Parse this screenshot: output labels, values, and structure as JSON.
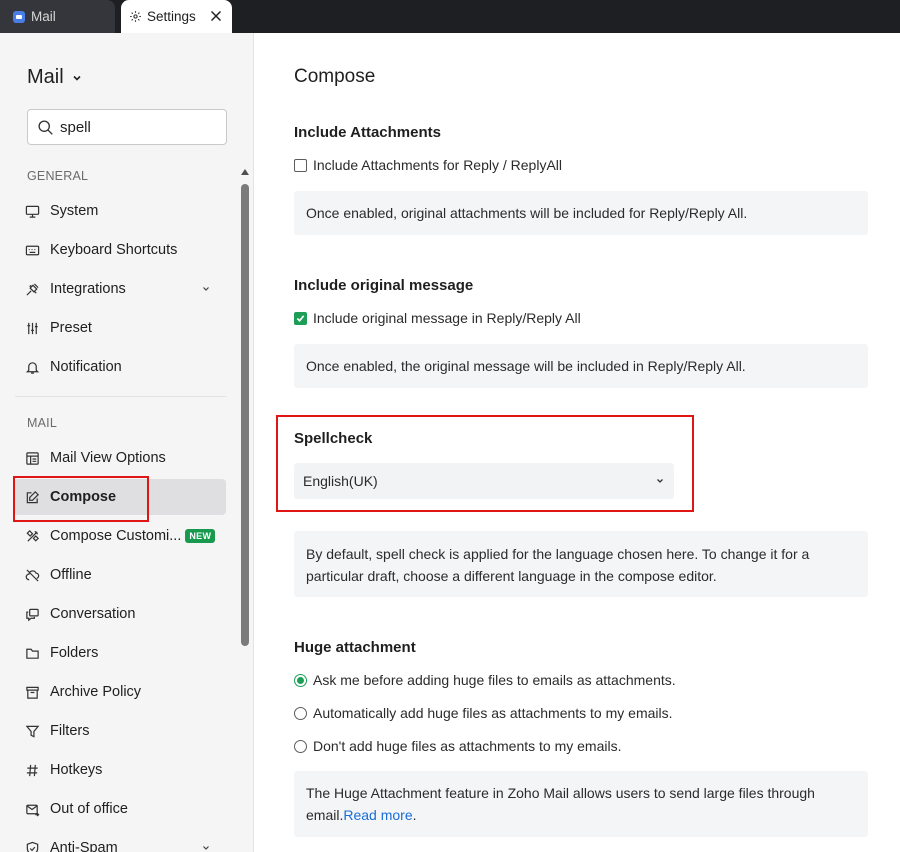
{
  "tabs": [
    {
      "label": "Mail"
    },
    {
      "label": "Settings"
    }
  ],
  "sidebar": {
    "app_title": "Mail",
    "search": {
      "value": "spell",
      "placeholder": "Search"
    },
    "general_label": "GENERAL",
    "general_items": [
      {
        "label": "System",
        "icon": "monitor-icon"
      },
      {
        "label": "Keyboard Shortcuts",
        "icon": "keyboard-icon"
      },
      {
        "label": "Integrations",
        "icon": "plug-icon",
        "expandable": true
      },
      {
        "label": "Preset",
        "icon": "sliders-icon"
      },
      {
        "label": "Notification",
        "icon": "bell-icon"
      }
    ],
    "mail_label": "MAIL",
    "mail_items": [
      {
        "label": "Mail View Options",
        "icon": "layout-icon"
      },
      {
        "label": "Compose",
        "icon": "edit-icon",
        "active": true
      },
      {
        "label": "Compose Customi...",
        "icon": "tools-icon",
        "badge": "NEW"
      },
      {
        "label": "Offline",
        "icon": "cloud-off-icon"
      },
      {
        "label": "Conversation",
        "icon": "chat-icon"
      },
      {
        "label": "Folders",
        "icon": "folder-icon"
      },
      {
        "label": "Archive Policy",
        "icon": "archive-icon"
      },
      {
        "label": "Filters",
        "icon": "filter-icon"
      },
      {
        "label": "Hotkeys",
        "icon": "hash-icon"
      },
      {
        "label": "Out of office",
        "icon": "mail-out-icon"
      },
      {
        "label": "Anti-Spam",
        "icon": "shield-check-icon",
        "expandable": true
      }
    ]
  },
  "main": {
    "title": "Compose",
    "attachments": {
      "heading": "Include Attachments",
      "option": "Include Attachments for Reply / ReplyAll",
      "checked": false,
      "info": "Once enabled, original attachments will be included for Reply/Reply All."
    },
    "original": {
      "heading": "Include original message",
      "option": "Include original message in Reply/Reply All",
      "checked": true,
      "info": "Once enabled, the original message will be included in Reply/Reply All."
    },
    "spellcheck": {
      "heading": "Spellcheck",
      "selected": "English(UK)",
      "info": "By default, spell check is applied for the language chosen here. To change it for a particular draft, choose a different language in the compose editor."
    },
    "huge": {
      "heading": "Huge attachment",
      "options": [
        {
          "label": "Ask me before adding huge files to emails as attachments.",
          "selected": true
        },
        {
          "label": "Automatically add huge files as attachments to my emails.",
          "selected": false
        },
        {
          "label": "Don't add huge files as attachments to my emails.",
          "selected": false
        }
      ],
      "info_text": "The Huge Attachment feature in Zoho Mail allows users to send large files through email.",
      "info_link": "Read more",
      "info_end": "."
    }
  },
  "colors": {
    "accent_green": "#1d9e57",
    "highlight_red": "#e01515",
    "link_blue": "#1a6dd6"
  }
}
